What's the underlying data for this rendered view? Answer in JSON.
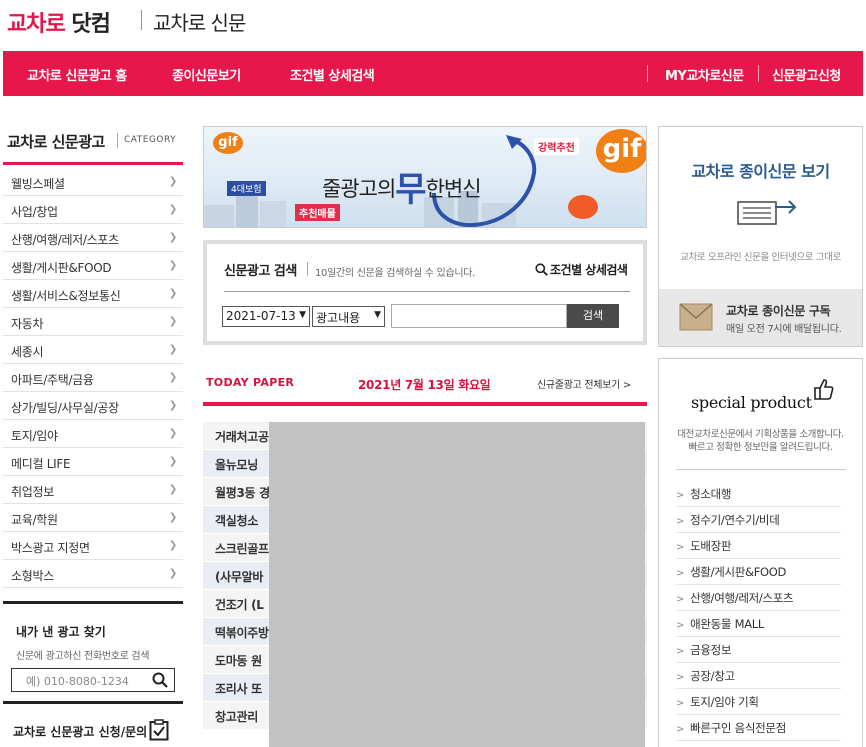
{
  "header": {
    "logo_main": "교차로",
    "logo_dot": "닷컴",
    "logo_sub": "교차로 신문"
  },
  "nav": {
    "items": [
      "교차로 신문광고 홈",
      "종이신문보기",
      "조건별 상세검색"
    ],
    "right_items": [
      "MY교차로신문",
      "신문광고신청"
    ]
  },
  "sidebar": {
    "title": "교차로 신문광고",
    "title_en": "CATEGORY",
    "categories": [
      "웰빙스페셜",
      "사업/창업",
      "산행/여행/레저/스포츠",
      "생활/게시판&FOOD",
      "생활/서비스&정보통신",
      "자동차",
      "세종시",
      "아파트/주택/금융",
      "상가/빌딩/사무실/공장",
      "토지/임야",
      "메디컬 LIFE",
      "취업정보",
      "교육/학원",
      "박스광고 지정면",
      "소형박스"
    ],
    "find": {
      "title": "내가 낸 광고 찾기",
      "desc": "신문에 광고하신 전화번호로 검색",
      "placeholder": "예) 010-8080-1234"
    },
    "apply_title": "교차로 신문광고 신청/문의"
  },
  "banner": {
    "gif_small": "gif",
    "gif_big": "gif",
    "text_pre": "줄광고의",
    "text_big": "무",
    "text_post": "한변신",
    "tag_strong": "강력추천",
    "tag_recommend": "추천매물",
    "tag_4": "4대보험"
  },
  "search": {
    "title": "신문광고 검색",
    "desc": "10일간의 신문을 검색하실 수 있습니다.",
    "advanced": "조건별 상세검색",
    "date_value": "2021-07-13",
    "type_value": "광고내용",
    "button": "검색"
  },
  "today": {
    "label": "TODAY PAPER",
    "date": "2021년 7월 13일 화요일",
    "more": "신규줄광고 전체보기 >"
  },
  "ads": [
    "거래처고공",
    "올뉴모닝",
    "월평3동 경",
    "객실청소",
    "스크린골프",
    "(사무알바",
    "건조기 (L",
    "떡볶이주방",
    "도마동 원",
    "조리사 또",
    "창고관리"
  ],
  "right_panel": {
    "paper_title": "교차로 종이신문 보기",
    "paper_desc": "교차로 오프라인 신문을 인터넷으로 그대로",
    "subscribe_title": "교차로 종이신문 구독",
    "subscribe_desc": "매일 오전 7시에 배달됩니다.",
    "special_title": "special product",
    "special_desc_1": "대전교차로신문에서 기획상품을 소개합니다.",
    "special_desc_2": "빠르고 정확한 정보만을 알려드립니다.",
    "special_items": [
      "청소대행",
      "정수기/연수기/비데",
      "도배장판",
      "생활/게시판&FOOD",
      "산행/여행/레저/스포츠",
      "애완동물 MALL",
      "금융정보",
      "공장/창고",
      "토지/임야 기획",
      "빠른구인 음식전문점"
    ]
  },
  "colors": {
    "brand_red": "#e8174b",
    "heading_blue": "#2c5a8f",
    "today_red": "#d51440"
  }
}
